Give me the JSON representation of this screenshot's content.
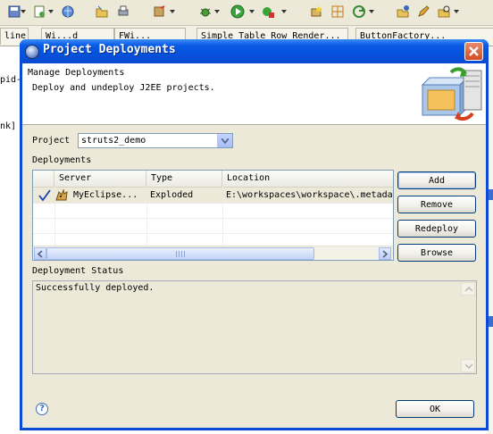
{
  "workbench": {
    "tabs": [
      "line",
      "Wi...d",
      "FWi...",
      "Simple Table Row Render...",
      "ButtonFactory..."
    ],
    "editor_fragments": [
      "pid-",
      "nk]"
    ],
    "toolbar_icons": [
      "save-icon",
      "new-wizard-icon",
      "globe-icon",
      "open-folder-icon",
      "print-icon",
      "build-icon",
      "debug-icon",
      "run-icon",
      "external-tools-icon",
      "new-package-icon",
      "new-class-icon",
      "refresh-icon",
      "open-type-icon",
      "edit-icon",
      "search-icon"
    ]
  },
  "dialog": {
    "title": "Project Deployments",
    "header": {
      "title": "Manage Deployments",
      "subtitle": "Deploy and undeploy J2EE projects."
    },
    "project_label": "Project",
    "project_value": "struts2_demo",
    "deployments_label": "Deployments",
    "table": {
      "columns": [
        "Server",
        "Type",
        "Location"
      ],
      "rows": [
        {
          "server": "MyEclipse...",
          "type": "Exploded",
          "location": "E:\\workspaces\\workspace\\.metada",
          "checked": true
        }
      ]
    },
    "buttons": {
      "add": "Add",
      "remove": "Remove",
      "redeploy": "Redeploy",
      "browse": "Browse",
      "ok": "OK"
    },
    "status_label": "Deployment Status",
    "status_text": "Successfully deployed.",
    "help_symbol": "?"
  },
  "colors": {
    "titlebar": "#0553df",
    "close_button": "#d44a22",
    "dialog_bg": "#ece9d8",
    "check": "#1c3fb5"
  }
}
